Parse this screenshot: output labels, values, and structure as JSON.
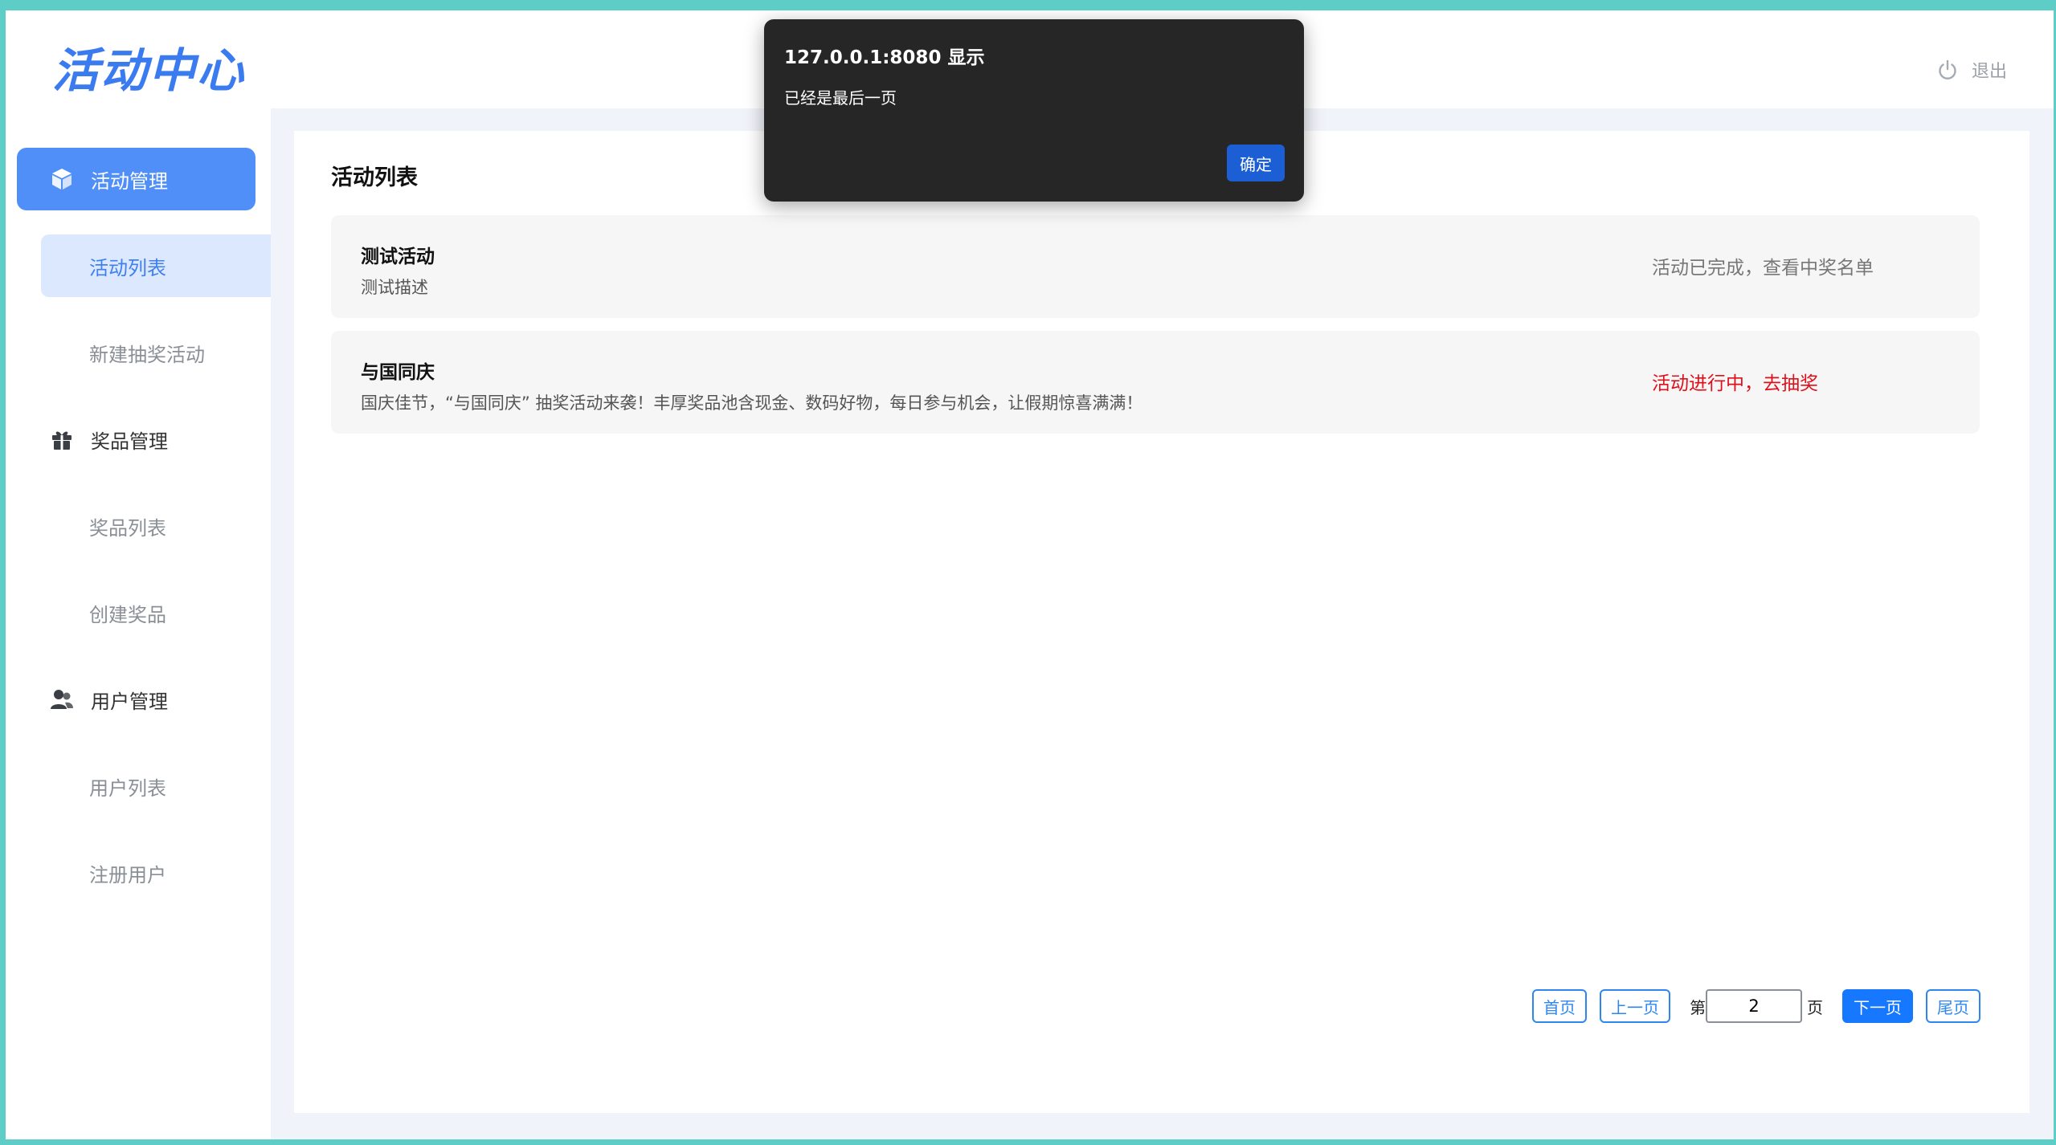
{
  "header": {
    "logo_text": "活动中心",
    "logout_label": "退出"
  },
  "sidebar": {
    "groups": [
      {
        "label": "活动管理",
        "icon": "cube-icon"
      },
      {
        "label": "奖品管理",
        "icon": "gift-icon"
      },
      {
        "label": "用户管理",
        "icon": "users-icon"
      }
    ],
    "items": [
      {
        "label": "活动列表"
      },
      {
        "label": "新建抽奖活动"
      },
      {
        "label": "奖品列表"
      },
      {
        "label": "创建奖品"
      },
      {
        "label": "用户列表"
      },
      {
        "label": "注册用户"
      }
    ]
  },
  "main": {
    "title": "活动列表",
    "activities": [
      {
        "name": "测试活动",
        "description": "测试描述",
        "status": "活动已完成，查看中奖名单"
      },
      {
        "name": "与国同庆",
        "description": "国庆佳节，“与国同庆” 抽奖活动来袭！丰厚奖品池含现金、数码好物，每日参与机会，让假期惊喜满满！",
        "status": "活动进行中，去抽奖"
      }
    ],
    "pagination": {
      "first": "首页",
      "prev": "上一页",
      "page_prefix": "第",
      "current_page": "2",
      "page_suffix": "页",
      "next": "下一页",
      "last": "尾页"
    }
  },
  "dialog": {
    "origin": "127.0.0.1:8080 显示",
    "message": "已经是最后一页",
    "ok_label": "确定"
  },
  "colors": {
    "accent": "#4f8ff7",
    "active_status": "#e0101a",
    "dialog_bg": "#262626"
  }
}
